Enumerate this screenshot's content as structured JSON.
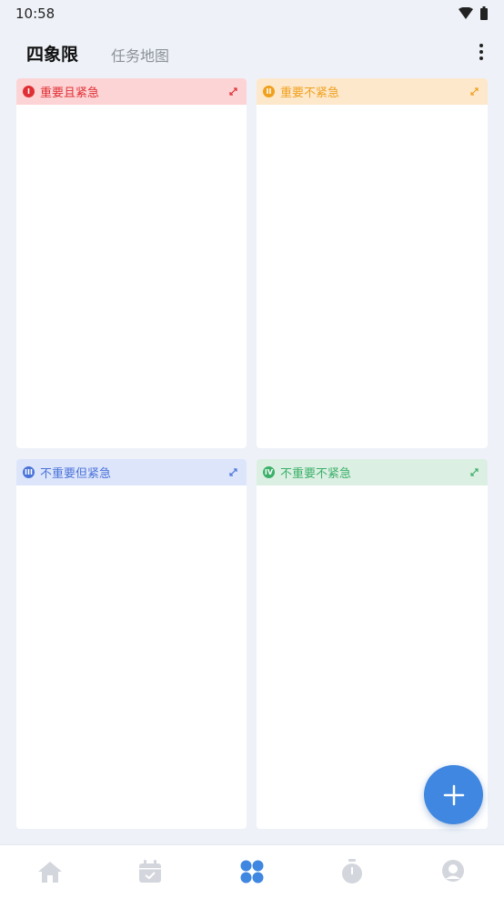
{
  "status": {
    "time": "10:58"
  },
  "header": {
    "tab_active": "四象限",
    "tab_inactive": "任务地图"
  },
  "quadrants": [
    {
      "badge": "I",
      "title": "重要且紧急",
      "color": "#e02f34",
      "bg": "#fdd4d6"
    },
    {
      "badge": "II",
      "title": "重要不紧急",
      "color": "#f0a01d",
      "bg": "#fde8cb"
    },
    {
      "badge": "III",
      "title": "不重要但紧急",
      "color": "#4a73d8",
      "bg": "#dde5fb"
    },
    {
      "badge": "IV",
      "title": "不重要不紧急",
      "color": "#3bb068",
      "bg": "#dcefe3"
    }
  ],
  "nav": {
    "items": [
      "home-icon",
      "calendar-check-icon",
      "quadrant-icon",
      "timer-icon",
      "profile-icon"
    ],
    "active_color": "#3f87e0",
    "inactive_color": "#d3d6dc"
  }
}
